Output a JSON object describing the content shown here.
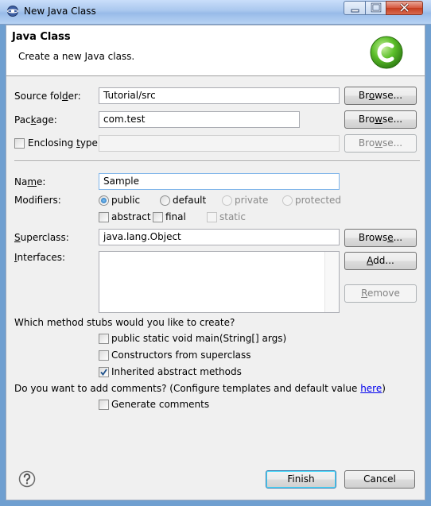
{
  "window": {
    "title": "New Java Class"
  },
  "banner": {
    "title": "Java Class",
    "description": "Create a new Java class."
  },
  "source_folder": {
    "label_pre": "Source fol",
    "label_u": "d",
    "label_post": "er:",
    "value": "Tutorial/src",
    "browse_pre": "Br",
    "browse_u": "o",
    "browse_post": "wse..."
  },
  "package": {
    "label_pre": "Pac",
    "label_u": "k",
    "label_post": "age:",
    "value": "com.test",
    "browse_pre": "Bro",
    "browse_u": "w",
    "browse_post": "se..."
  },
  "enclosing": {
    "label_pre": "Enclosing ",
    "label_u": "t",
    "label_post": "ype:",
    "value": "",
    "browse_pre": "Bro",
    "browse_u": "w",
    "browse_post": "se..."
  },
  "name": {
    "label_pre": "Na",
    "label_u": "m",
    "label_post": "e:",
    "value": "Sample"
  },
  "modifiers": {
    "label": "Modifiers:",
    "public": "public",
    "default": "default",
    "private": "private",
    "protected": "protected",
    "abstract": "abstract",
    "final": "final",
    "static": "static"
  },
  "superclass": {
    "label_pre": "",
    "label_u": "S",
    "label_post": "uperclass:",
    "value": "java.lang.Object",
    "browse_pre": "Brows",
    "browse_u": "e",
    "browse_post": "..."
  },
  "interfaces": {
    "label_pre": "",
    "label_u": "I",
    "label_post": "nterfaces:",
    "add_pre": "",
    "add_u": "A",
    "add_post": "dd...",
    "remove_pre": "",
    "remove_u": "R",
    "remove_post": "emove"
  },
  "stubs": {
    "question": "Which method stubs would you like to create?",
    "main": "public static void main(String[] args)",
    "constructors": "Constructors from superclass",
    "inherited": "Inherited abstract methods"
  },
  "comments": {
    "question_pre": "Do you want to add comments? (Configure templates and default value ",
    "link": "here",
    "question_post": ")",
    "generate": "Generate comments"
  },
  "footer": {
    "finish": "Finish",
    "cancel": "Cancel"
  }
}
